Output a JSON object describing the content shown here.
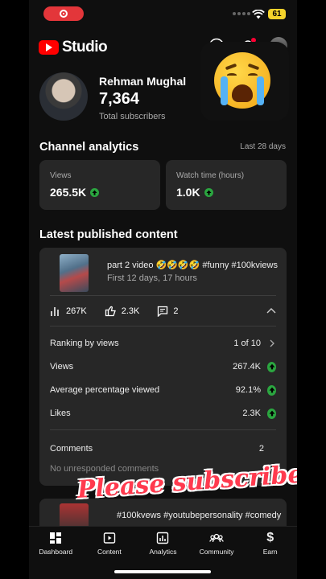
{
  "status_bar": {
    "battery": "61"
  },
  "header": {
    "logo_text": "Studio",
    "icons": [
      "plus-icon",
      "bell-icon",
      "avatar"
    ]
  },
  "channel": {
    "name": "Rehman Mughal",
    "subscribers": "7,364",
    "subscribers_label": "Total subscribers"
  },
  "analytics": {
    "title": "Channel analytics",
    "range": "Last 28 days",
    "cards": [
      {
        "label": "Views",
        "value": "265.5K",
        "trend": "up"
      },
      {
        "label": "Watch time (hours)",
        "value": "1.0K",
        "trend": "up"
      }
    ]
  },
  "latest": {
    "title": "Latest published content",
    "video": {
      "title": "part 2 video 🤣🤣🤣🤣 #funny #100kviews",
      "age": "First 12 days, 17 hours",
      "stats": {
        "views": "267K",
        "likes": "2.3K",
        "comments": "2"
      },
      "metrics": [
        {
          "label": "Ranking by views",
          "value": "1 of 10",
          "icon": "chevron-right-icon"
        },
        {
          "label": "Views",
          "value": "267.4K",
          "icon": "up-icon"
        },
        {
          "label": "Average percentage viewed",
          "value": "92.1%",
          "icon": "up-icon"
        },
        {
          "label": "Likes",
          "value": "2.3K",
          "icon": "up-icon"
        }
      ],
      "comments_label": "Comments",
      "comments_value": "2",
      "no_unresponded": "No unresponded comments"
    },
    "video2": {
      "title": "#100kvews #youtubepersonality #comedy"
    }
  },
  "overlay_text": "Please subscribe",
  "nav": [
    {
      "label": "Dashboard",
      "icon": "dashboard-icon"
    },
    {
      "label": "Content",
      "icon": "content-icon"
    },
    {
      "label": "Analytics",
      "icon": "analytics-icon"
    },
    {
      "label": "Community",
      "icon": "community-icon"
    },
    {
      "label": "Earn",
      "icon": "earn-icon"
    }
  ],
  "colors": {
    "accent_red": "#ff0000",
    "up_green": "#2ba640",
    "card_bg": "#272727"
  }
}
